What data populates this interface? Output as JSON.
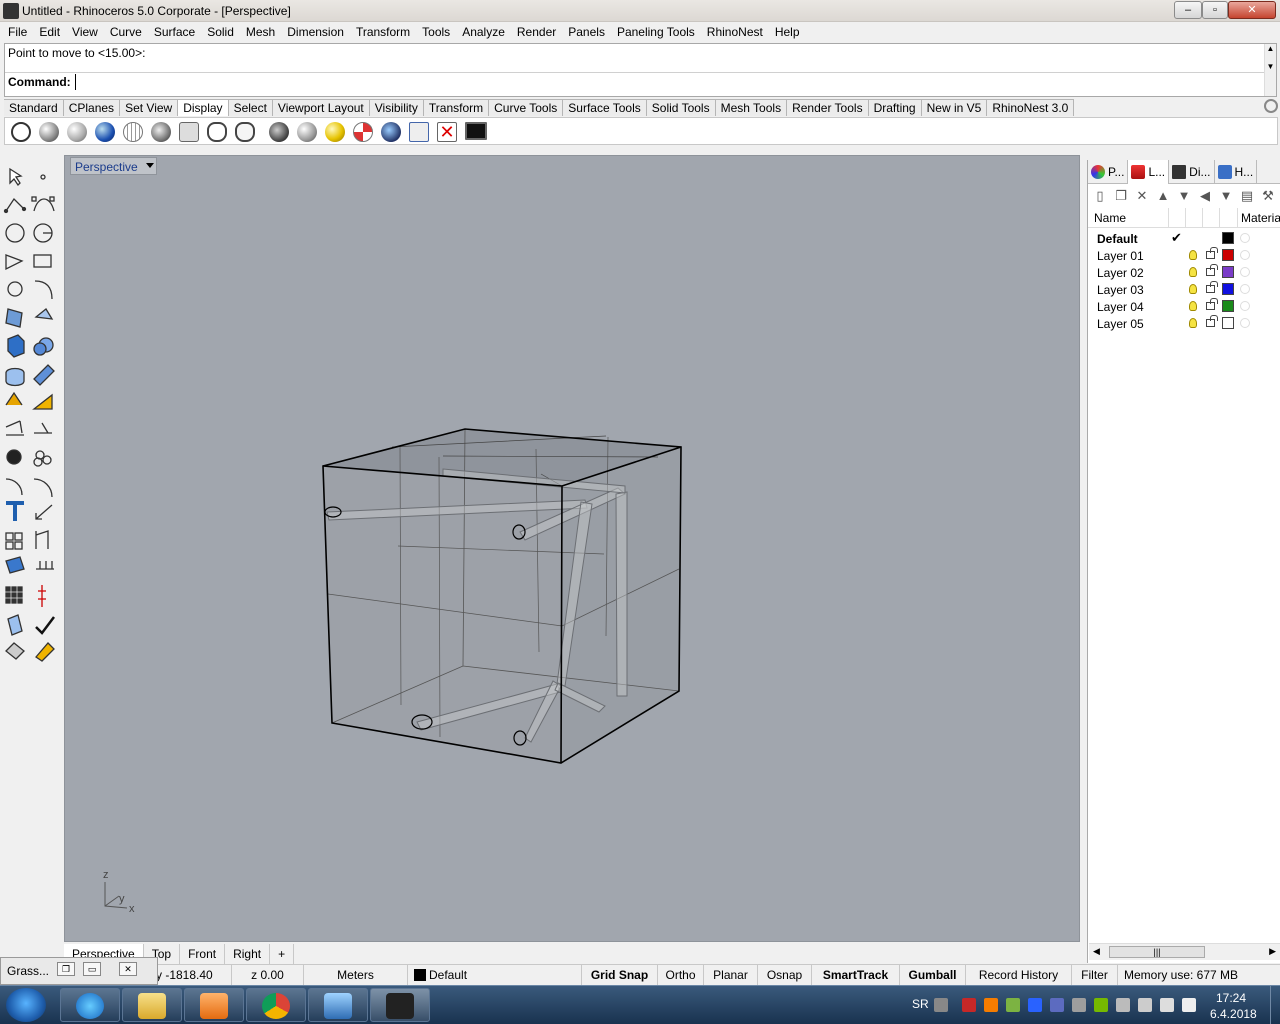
{
  "window": {
    "title": "Untitled - Rhinoceros  5.0 Corporate - [Perspective]"
  },
  "menu": [
    "File",
    "Edit",
    "View",
    "Curve",
    "Surface",
    "Solid",
    "Mesh",
    "Dimension",
    "Transform",
    "Tools",
    "Analyze",
    "Render",
    "Panels",
    "Paneling Tools",
    "RhinoNest",
    "Help"
  ],
  "command": {
    "history": "Point to move to <15.00>:",
    "label": "Command:",
    "value": ""
  },
  "toolbar_tabs": {
    "items": [
      "Standard",
      "CPlanes",
      "Set View",
      "Display",
      "Select",
      "Viewport Layout",
      "Visibility",
      "Transform",
      "Curve Tools",
      "Surface Tools",
      "Solid Tools",
      "Mesh Tools",
      "Render Tools",
      "Drafting",
      "New in V5",
      "RhinoNest 3.0"
    ],
    "active": "Display"
  },
  "viewport": {
    "title": "Perspective",
    "axis": {
      "z": "z",
      "y": "y",
      "x": "x"
    }
  },
  "view_tabs": [
    "Perspective",
    "Top",
    "Front",
    "Right",
    "+"
  ],
  "panel": {
    "tabs": [
      "P...",
      "L...",
      "Di...",
      "H..."
    ],
    "header": {
      "name": "Name",
      "material": "Material"
    },
    "layers": [
      {
        "name": "Default",
        "color": "#000000",
        "current": true
      },
      {
        "name": "Layer 01",
        "color": "#cc0000",
        "current": false
      },
      {
        "name": "Layer 02",
        "color": "#7a3cc8",
        "current": false
      },
      {
        "name": "Layer 03",
        "color": "#1010e0",
        "current": false
      },
      {
        "name": "Layer 04",
        "color": "#1a8a1a",
        "current": false
      },
      {
        "name": "Layer 05",
        "color": "#ffffff",
        "current": false
      }
    ]
  },
  "status": {
    "y": "y -1818.40",
    "z": "z 0.00",
    "units": "Meters",
    "layer": "Default",
    "grid_snap": "Grid Snap",
    "ortho": "Ortho",
    "planar": "Planar",
    "osnap": "Osnap",
    "smarttrack": "SmartTrack",
    "gumball": "Gumball",
    "record_history": "Record History",
    "filter": "Filter",
    "memory": "Memory use: 677 MB"
  },
  "grasshopper": {
    "title": "Grass..."
  },
  "taskbar": {
    "lang": "SR",
    "time": "17:24",
    "date": "6.4.2018"
  }
}
